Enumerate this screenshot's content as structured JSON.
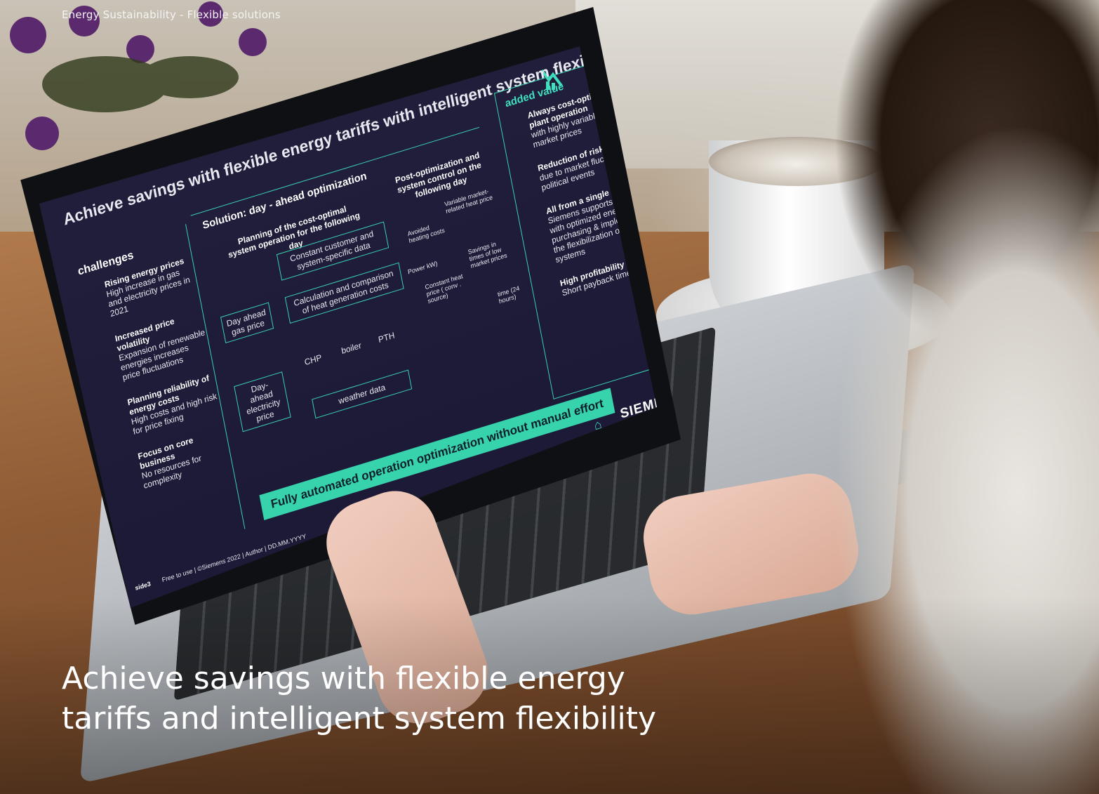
{
  "header": {
    "breadcrumb": "Energy Sustainability - Flexible solutions"
  },
  "hero": {
    "headline_line1": "Achieve savings with flexible energy",
    "headline_line2": "tariffs and intelligent system flexibility"
  },
  "laptop_slide": {
    "title": "Achieve savings with flexible energy tariffs with intelligent system flexibility",
    "challenges": {
      "heading": "challenges",
      "items": [
        {
          "title": "Rising energy prices",
          "text": "High increase in gas and electricity prices in 2021"
        },
        {
          "title": "Increased price volatility",
          "text": "Expansion of renewable energies increases price fluctuations"
        },
        {
          "title": "Planning reliability of energy costs",
          "text": "High costs and high risk for price fixing"
        },
        {
          "title": "Focus on core business",
          "text": "No resources for complexity"
        }
      ]
    },
    "solution": {
      "heading": "Solution: day - ahead optimization",
      "planning": "Planning of the cost-optimal system operation for the following day",
      "constant_data": "Constant customer and system-specific data",
      "calculation": "Calculation and comparison of heat generation costs",
      "gas_price": "Day ahead gas price",
      "electricity_price": "Day- ahead electricity price",
      "chp": "CHP",
      "boiler": "boiler",
      "pth": "PTH",
      "weather": "weather data",
      "post_optimization": "Post-optimization and system control on the following day",
      "chart_labels": {
        "avoided": "Avoided heating costs",
        "variable": "Variable market-related heat price",
        "savings": "Savings in times of low market prices",
        "constant": "Constant heat price ( conv . source)",
        "y_axis": "Power kW)",
        "x_axis": "time (24 hours)"
      }
    },
    "added_value": {
      "heading": "added value",
      "items": [
        {
          "title": "Always cost-optimized plant operation",
          "text": "with highly variable market prices"
        },
        {
          "title": "Reduction of risk",
          "text": "due to market fluctuations political events"
        },
        {
          "title": "All from a single source",
          "text": "Siemens supports you with optimized energy purchasing & implements the flexibilization of your systems"
        },
        {
          "title": "High profitability",
          "text": "Short payback times"
        }
      ]
    },
    "banner": "Fully automated operation optimization without manual effort",
    "brand": "SIEMENS",
    "footer_page": "side3",
    "footer_text": "Free to use | ©Siemens 2022 | Author | DD.MM.YYYY"
  },
  "icons": {
    "home": "home-icon",
    "logo": "chart-down-icon"
  },
  "colors": {
    "accent": "#37d3ad",
    "screen_bg": "#1b1935"
  }
}
